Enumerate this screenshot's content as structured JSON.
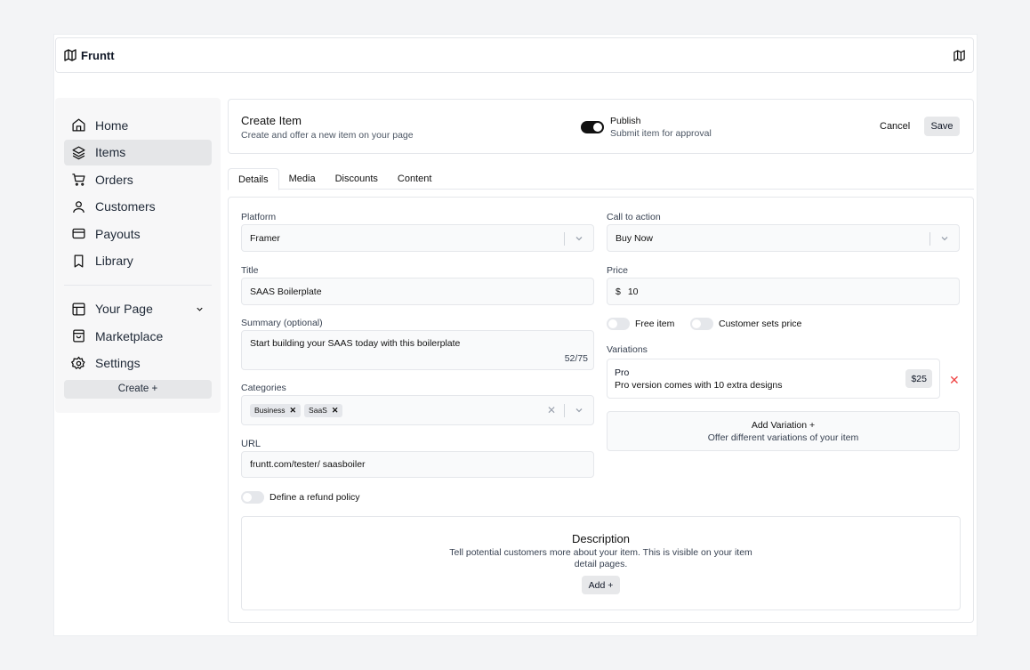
{
  "app": {
    "name": "Fruntt"
  },
  "sidebar": {
    "items": [
      {
        "label": "Home",
        "icon": "home-icon"
      },
      {
        "label": "Items",
        "icon": "layers-icon",
        "active": true
      },
      {
        "label": "Orders",
        "icon": "cart-icon"
      },
      {
        "label": "Customers",
        "icon": "user-icon"
      },
      {
        "label": "Payouts",
        "icon": "card-icon"
      },
      {
        "label": "Library",
        "icon": "bookmark-icon"
      }
    ],
    "secondary": [
      {
        "label": "Your Page",
        "icon": "layout-icon"
      },
      {
        "label": "Marketplace",
        "icon": "inbox-icon"
      },
      {
        "label": "Settings",
        "icon": "gear-icon"
      }
    ],
    "create_label": "Create +"
  },
  "header": {
    "title": "Create Item",
    "subtitle": "Create and offer a new item on your page",
    "publish_title": "Publish",
    "publish_subtitle": "Submit item for approval",
    "cancel_label": "Cancel",
    "save_label": "Save"
  },
  "tabs": [
    {
      "label": "Details",
      "active": true
    },
    {
      "label": "Media"
    },
    {
      "label": "Discounts"
    },
    {
      "label": "Content"
    }
  ],
  "form": {
    "platform_label": "Platform",
    "platform_value": "Framer",
    "title_label": "Title",
    "title_value": "SAAS Boilerplate",
    "summary_label": "Summary (optional)",
    "summary_value": "Start building your SAAS today with this boilerplate",
    "summary_counter": "52/75",
    "categories_label": "Categories",
    "categories": [
      "Business",
      "SaaS"
    ],
    "url_label": "URL",
    "url_value": "fruntt.com/tester/  saasboiler",
    "refund_label": "Define a refund policy",
    "cta_label": "Call to action",
    "cta_value": "Buy Now",
    "price_label": "Price",
    "price_currency": "$",
    "price_value": "10",
    "free_item_label": "Free item",
    "customer_price_label": "Customer sets price",
    "variations_label": "Variations",
    "variation": {
      "name": "Pro",
      "description": "Pro version comes with 10 extra designs",
      "price": "$25"
    },
    "add_variation_title": "Add Variation +",
    "add_variation_subtitle": "Offer different variations of your item",
    "description_title": "Description",
    "description_text": "Tell potential customers more about your item. This is visible on your item detail pages.",
    "description_add": "Add +"
  }
}
